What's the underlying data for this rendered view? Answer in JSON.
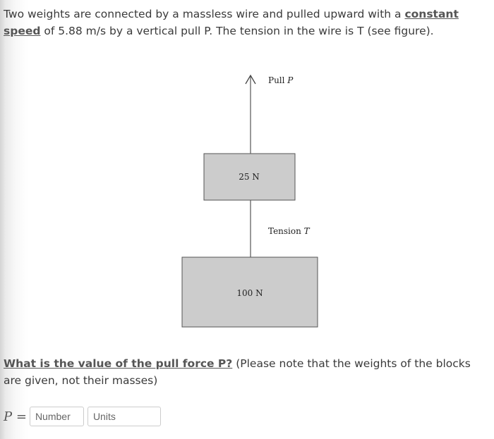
{
  "problem": {
    "intro_before": "Two weights are connected by a massless wire and pulled upward with a ",
    "kw1": "constant",
    "kw2": "speed",
    "intro_after": " of 5.88 m/s by a vertical pull P. The tension in the wire is T (see figure).",
    "question_bold": "What is the value of the pull force P?",
    "question_rest": " (Please note that the weights of the blocks are given, not their masses)"
  },
  "figure": {
    "pull_label": "Pull ",
    "pull_var": "P",
    "tension_label": "Tension ",
    "tension_var": "T",
    "upper_block": "25 N",
    "lower_block": "100 N",
    "block_fill": "#cccccc"
  },
  "answer": {
    "var": "P",
    "equals": " =",
    "number_placeholder": "Number",
    "units_placeholder": "Units"
  }
}
